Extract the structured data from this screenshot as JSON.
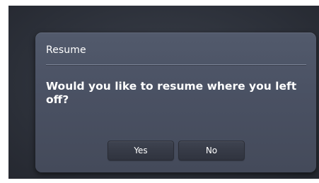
{
  "dialog": {
    "title": "Resume",
    "message": "Would you like to resume where you left off?",
    "buttons": {
      "yes_label": "Yes",
      "no_label": "No"
    }
  },
  "colors": {
    "background": "#2b2f38",
    "dialog": "#4a5163",
    "button": "#353945",
    "text": "#ffffff"
  }
}
